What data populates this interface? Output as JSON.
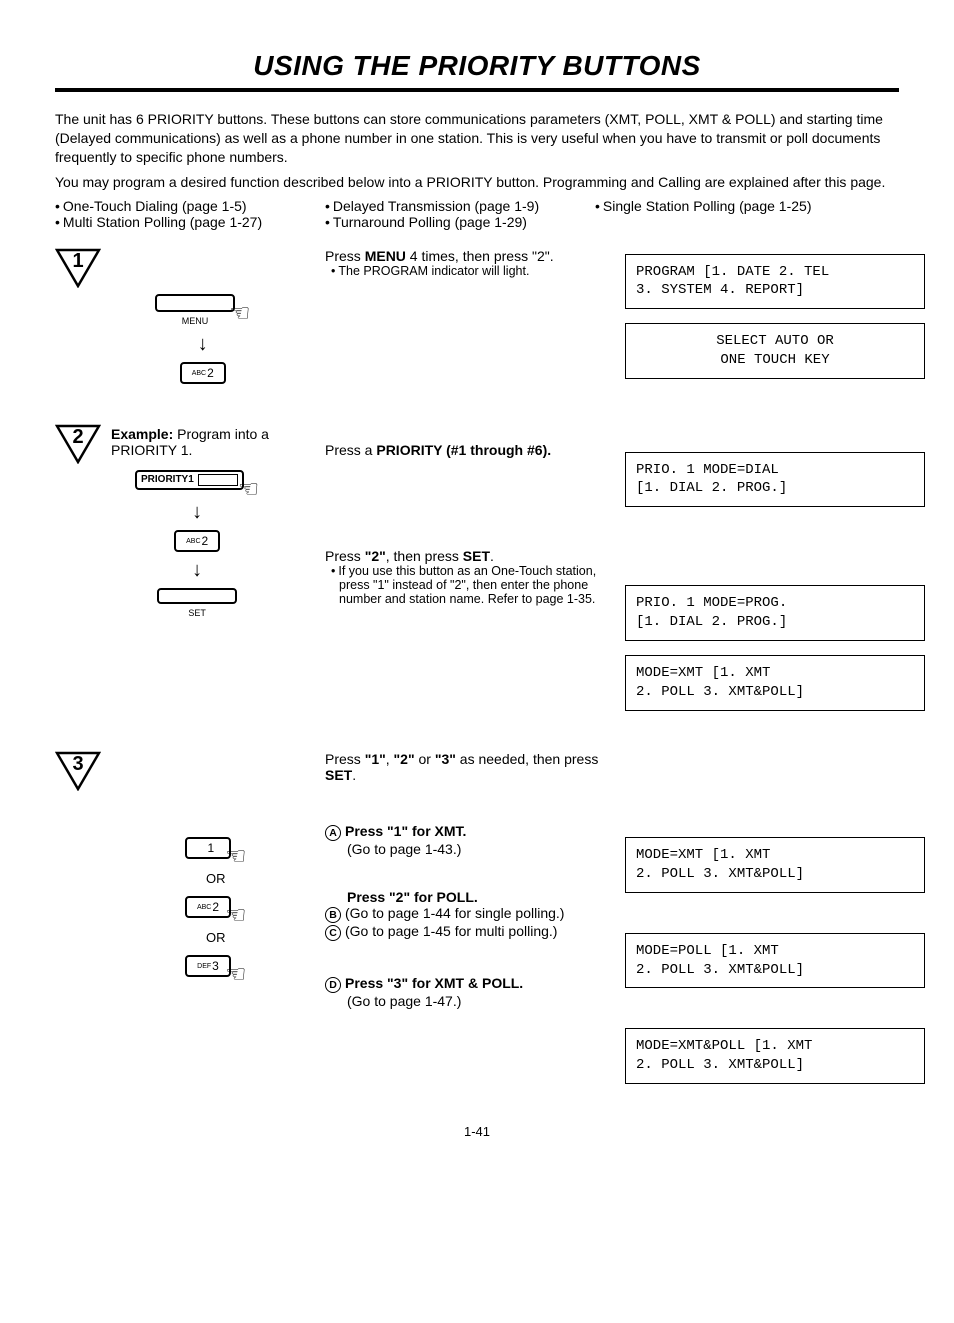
{
  "title": "USING THE PRIORITY BUTTONS",
  "intro1": "The unit has 6 PRIORITY buttons. These buttons can store communications parameters (XMT, POLL, XMT & POLL) and starting time (Delayed communications) as well as a phone number in one station. This is very useful when you have to transmit or poll documents frequently to specific phone numbers.",
  "intro2": "You may program a desired function described below into a PRIORITY button. Programming and Calling are explained after this page.",
  "bullets_col1_a": "One-Touch Dialing (page 1-5)",
  "bullets_col1_b": "Multi Station Polling (page 1-27)",
  "bullets_col2_a": "Delayed Transmission (page 1-9)",
  "bullets_col2_b": "Turnaround Polling (page 1-29)",
  "bullets_col3_a": "Single Station Polling (page 1-25)",
  "step1": {
    "num": "1",
    "menu_label": "MENU",
    "key2_sub": "ABC",
    "key2_num": "2",
    "instr_pre": "Press ",
    "instr_bold": "MENU",
    "instr_post": " 4 times, then press \"2\".",
    "instr_sub": "The PROGRAM indicator will light.",
    "lcd1": "PROGRAM [1. DATE 2. TEL\n3. SYSTEM 4. REPORT]",
    "lcd2": "SELECT AUTO OR\nONE TOUCH KEY"
  },
  "step2": {
    "num": "2",
    "example_pre": "Example:",
    "example_post": "  Program into a PRIORITY 1.",
    "priority_label": "PRIORITY1",
    "key2_sub": "ABC",
    "key2_num": "2",
    "set_label": "SET",
    "instr1_pre": "Press a ",
    "instr1_bold": "PRIORITY (#1 through #6).",
    "instr2_pre": "Press ",
    "instr2_q2": "\"2\"",
    "instr2_mid": ", then press ",
    "instr2_set": "SET",
    "instr2_end": ".",
    "instr2_sub": "If you use this button as an One-Touch station, press \"1\" instead of \"2\", then enter the phone number and station name. Refer to page 1-35.",
    "lcd1": "PRIO. 1 MODE=DIAL\n[1. DIAL 2. PROG.]",
    "lcd2": "PRIO. 1 MODE=PROG.\n[1. DIAL 2. PROG.]",
    "lcd3": "MODE=XMT [1. XMT\n2. POLL 3. XMT&POLL]"
  },
  "step3": {
    "num": "3",
    "key1_num": "1",
    "key2_sub": "ABC",
    "key2_num": "2",
    "key3_sub": "DEF",
    "key3_num": "3",
    "or": "OR",
    "instr_top_pre": "Press ",
    "instr_top_q1": "\"1\"",
    "instr_top_c1": ", ",
    "instr_top_q2": "\"2\"",
    "instr_top_c2": " or ",
    "instr_top_q3": "\"3\"",
    "instr_top_mid": " as needed, then press ",
    "instr_top_set": "SET",
    "instr_top_end": ".",
    "a_letter": "A",
    "a_bold": "Press \"1\" for XMT.",
    "a_sub": "(Go to page 1-43.)",
    "b_bold": "Press \"2\" for POLL.",
    "b_letter": "B",
    "b_sub": "(Go to page 1-44 for single polling.)",
    "c_letter": "C",
    "c_sub": "(Go to page 1-45 for multi polling.)",
    "d_letter": "D",
    "d_bold": "Press \"3\" for XMT & POLL.",
    "d_sub": "(Go to page 1-47.)",
    "lcd1": "MODE=XMT [1. XMT\n2. POLL 3. XMT&POLL]",
    "lcd2": "MODE=POLL [1. XMT\n2. POLL 3. XMT&POLL]",
    "lcd3": "MODE=XMT&POLL [1. XMT\n2. POLL 3. XMT&POLL]"
  },
  "page_num": "1-41"
}
